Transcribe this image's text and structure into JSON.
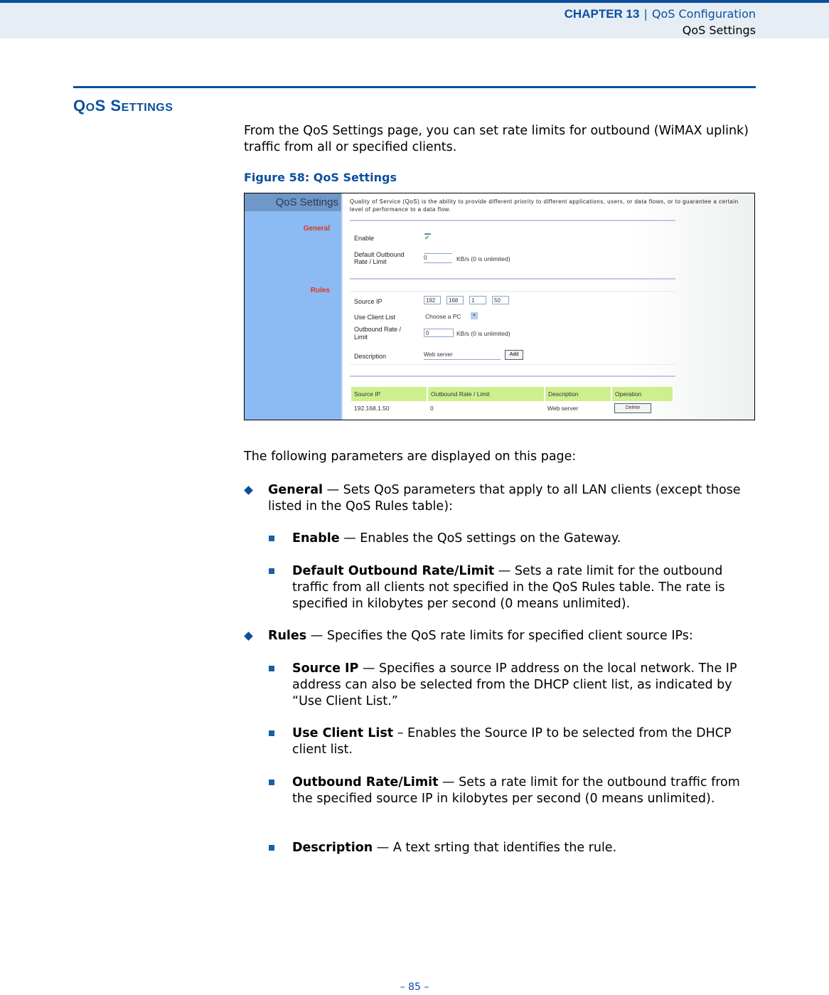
{
  "header": {
    "chapter": "CHAPTER 13",
    "separator": "|",
    "chapter_title": "QoS Configuration",
    "section": "QoS Settings"
  },
  "section_title_first": "Q",
  "section_title_first_small": "O",
  "section_title_s": "S ",
  "section_title_second": "S",
  "section_title_second_small": "ETTINGS",
  "intro": "From the QoS Settings page, you can set rate limits for outbound (WiMAX uplink) traffic from all or specified clients.",
  "figure": {
    "caption": "Figure 58:  QoS Settings",
    "sidebar_title": "QoS Settings",
    "sidebar_links": [
      "General",
      "Rules"
    ],
    "description": "Quality of Service (QoS) is the ability to provide different priority to different applications, users, or data flows, or to guarantee a certain level of performance to a data flow.",
    "general": {
      "enable_label": "Enable",
      "enable_checked": true,
      "default_rate_label_1": "Default Outbound",
      "default_rate_label_2": "Rate / Limit",
      "default_rate_value": "0",
      "default_rate_unit": "KB/s (0 is unlimited)"
    },
    "rules": {
      "source_ip_label": "Source IP",
      "source_ip": [
        "192",
        "168",
        "1",
        "50"
      ],
      "use_client_list_label": "Use Client List",
      "use_client_list_value": "Choose a PC",
      "rate_label_1": "Outbound Rate /",
      "rate_label_2": "Limit",
      "rate_value": "0",
      "rate_unit": "KB/s (0 is unlimited)",
      "description_label": "Description",
      "description_value": "Web server",
      "add_button": "Add"
    },
    "table": {
      "headers": [
        "Source IP",
        "Outbound Rate / Limit",
        "Description",
        "Operation"
      ],
      "rows": [
        {
          "source_ip": "192.168.1.50",
          "rate": "0",
          "description": "Web server",
          "operation": "Delete"
        }
      ]
    }
  },
  "params_intro": "The following parameters are displayed on this page:",
  "general_item": {
    "term": "General",
    "text": " — Sets QoS parameters that apply to all LAN clients (except those listed in the QoS Rules table):",
    "subitems": [
      {
        "term": "Enable",
        "text": " — Enables the QoS settings on the Gateway."
      },
      {
        "term": "Default Outbound Rate/Limit",
        "text": " — Sets a rate limit for the outbound traffic from all clients not specified in the QoS Rules table. The rate is specified in kilobytes per second (0 means unlimited)."
      }
    ]
  },
  "rules_item": {
    "term": "Rules",
    "text": " — Specifies the QoS rate limits for specified client source IPs:",
    "subitems": [
      {
        "term": "Source IP",
        "text": " — Specifies a source IP address on the local network. The IP address can also be selected from the DHCP client list, as indicated by “Use Client List.”"
      },
      {
        "term": "Use Client List",
        "text": " – Enables the Source IP to be selected from the DHCP client list."
      },
      {
        "term": "Outbound Rate/Limit",
        "text": " — Sets a rate limit for the outbound traffic from the specified source IP in kilobytes per second (0 means unlimited)."
      },
      {
        "term": "Description",
        "text": " — A text srting that identifies the rule."
      }
    ]
  },
  "page_number": "–  85  –"
}
